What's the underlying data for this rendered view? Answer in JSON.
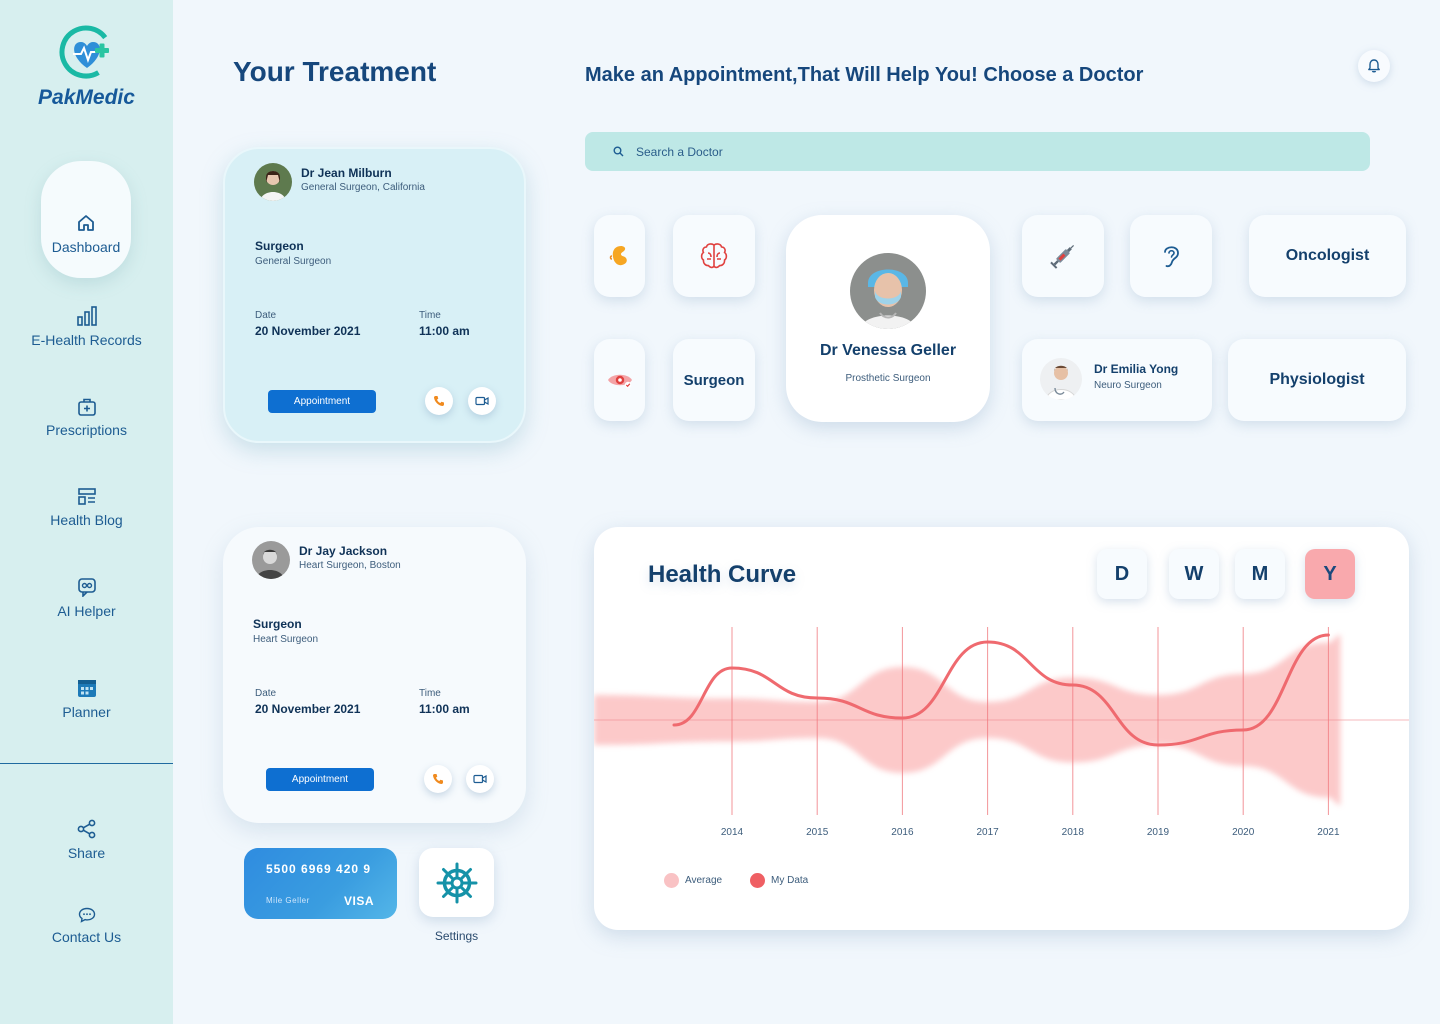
{
  "app": {
    "name": "PakMedic"
  },
  "sidebar": {
    "items": [
      {
        "label": "Dashboard",
        "icon": "home-icon"
      },
      {
        "label": "E-Health Records",
        "icon": "chart-icon"
      },
      {
        "label": "Prescriptions",
        "icon": "medical-kit-icon"
      },
      {
        "label": "Health Blog",
        "icon": "blog-icon"
      },
      {
        "label": "AI Helper",
        "icon": "chat-icon"
      },
      {
        "label": "Planner",
        "icon": "calendar-icon"
      },
      {
        "label": "Share",
        "icon": "share-icon"
      },
      {
        "label": "Contact Us",
        "icon": "message-icon"
      }
    ]
  },
  "header": {
    "treatment_title": "Your Treatment",
    "appointment_title": "Make an Appointment,That Will Help You! Choose a Doctor"
  },
  "search": {
    "placeholder": "Search a Doctor"
  },
  "treatments": [
    {
      "doctor": "Dr Jean Milburn",
      "subtitle": "General Surgeon, California",
      "role": "Surgeon",
      "role_sub": "General Surgeon",
      "date_label": "Date",
      "date": "20 November 2021",
      "time_label": "Time",
      "time": "11:00 am",
      "button": "Appointment"
    },
    {
      "doctor": "Dr Jay Jackson",
      "subtitle": "Heart Surgeon, Boston",
      "role": "Surgeon",
      "role_sub": "Heart Surgeon",
      "date_label": "Date",
      "date": "20 November 2021",
      "time_label": "Time",
      "time": "11:00 am",
      "button": "Appointment"
    }
  ],
  "payment": {
    "card_number": "5500 6969 420 9",
    "holder": "Mile Geller",
    "brand": "VISA"
  },
  "settings": {
    "label": "Settings"
  },
  "specialists": {
    "featured": {
      "name": "Dr Venessa Geller",
      "title": "Prosthetic Surgeon"
    },
    "emilia": {
      "name": "Dr Emilia Yong",
      "title": "Neuro Surgeon"
    },
    "surgeon": "Surgeon",
    "oncologist": "Oncologist",
    "physiologist": "Physiologist"
  },
  "colors": {
    "brand": "#16599a",
    "button": "#0e6fd1",
    "search_bg": "#bee8e6",
    "sidebar_bg": "#d7efef",
    "curve": "#ef6a6f",
    "band": "#fbb7b8"
  },
  "health_curve": {
    "title": "Health Curve",
    "periods": [
      "D",
      "W",
      "M",
      "Y"
    ],
    "active_period": "Y",
    "legend": [
      {
        "label": "Average",
        "color": "#f9c2c4"
      },
      {
        "label": "My Data",
        "color": "#ef5f63"
      }
    ]
  },
  "chart_data": {
    "type": "line",
    "title": "Health Curve",
    "x": [
      "2014",
      "2015",
      "2016",
      "2017",
      "2018",
      "2019",
      "2020",
      "2021"
    ],
    "series": [
      {
        "name": "My Data",
        "values": [
          0.52,
          0.22,
          0.02,
          0.78,
          0.35,
          -0.25,
          -0.1,
          0.85
        ]
      },
      {
        "name": "Average",
        "values": [
          0.05,
          0.0,
          0.5,
          0.0,
          0.35,
          0.1,
          0.4,
          0.85
        ]
      }
    ],
    "ylim": [
      -1,
      1
    ],
    "grid": true,
    "legend": "bottom-left"
  }
}
